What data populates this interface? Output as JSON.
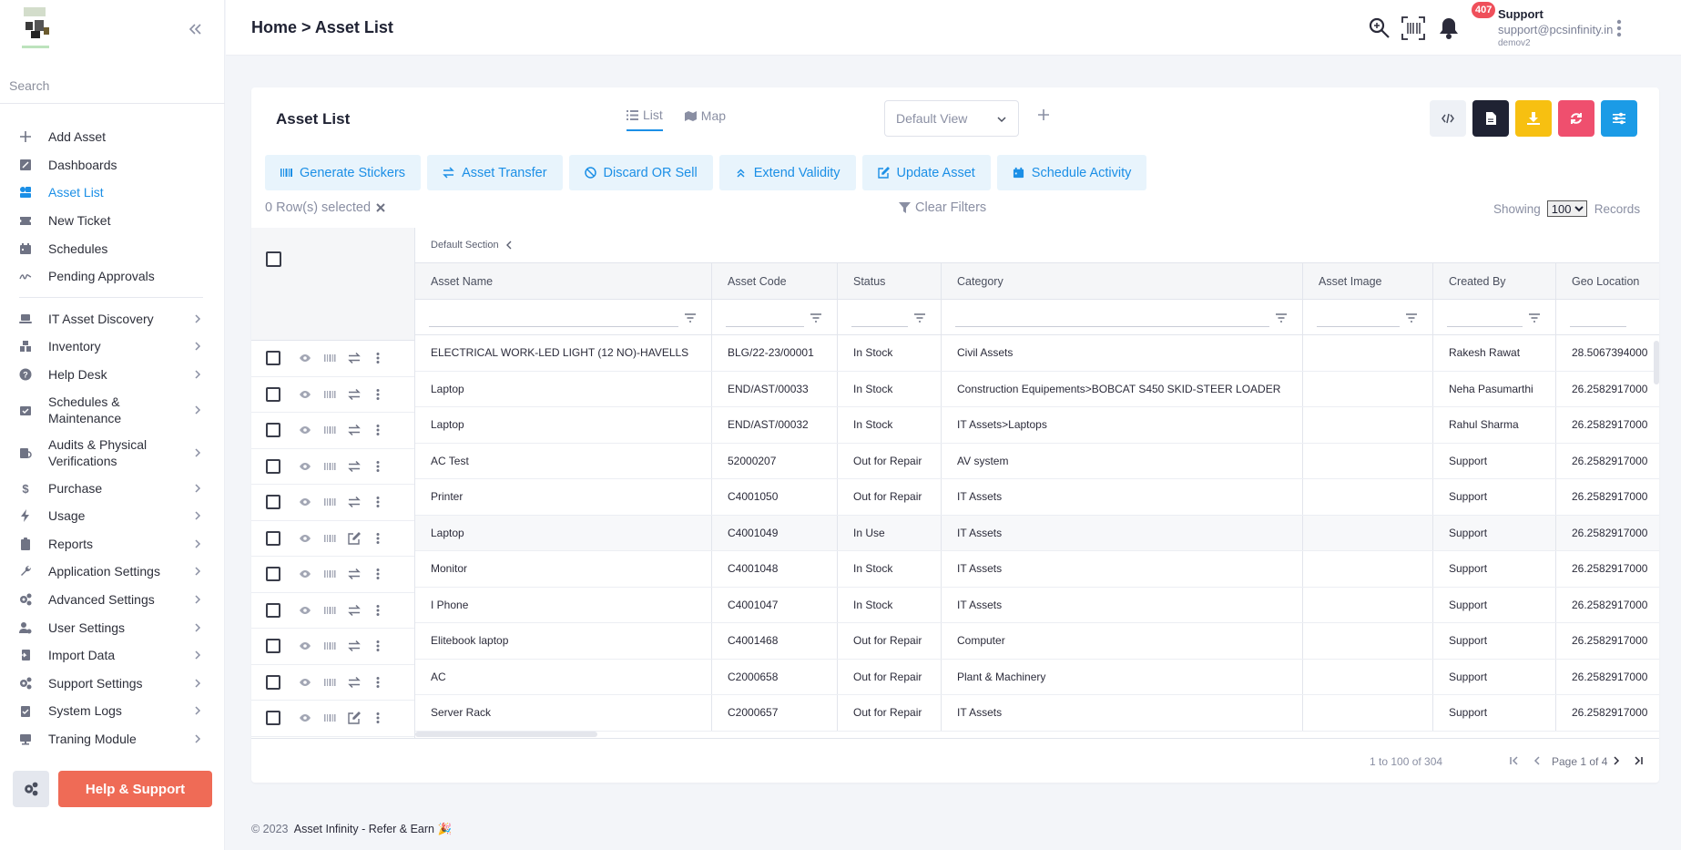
{
  "sidebar": {
    "search_placeholder": "Search",
    "primary_items": [
      {
        "label": "Add Asset",
        "icon": "plus-icon"
      },
      {
        "label": "Dashboards",
        "icon": "dashboard-icon"
      },
      {
        "label": "Asset List",
        "icon": "asset-list-icon",
        "active": true
      },
      {
        "label": "New Ticket",
        "icon": "ticket-icon"
      },
      {
        "label": "Schedules",
        "icon": "calendar-icon"
      },
      {
        "label": "Pending Approvals",
        "icon": "signature-icon"
      }
    ],
    "group_items": [
      {
        "label": "IT Asset Discovery",
        "icon": "laptop-icon"
      },
      {
        "label": "Inventory",
        "icon": "inventory-icon"
      },
      {
        "label": "Help Desk",
        "icon": "question-icon"
      },
      {
        "label": "Schedules & Maintenance",
        "icon": "calendar-check-icon"
      },
      {
        "label": "Audits & Physical Verifications",
        "icon": "audit-icon"
      },
      {
        "label": "Purchase",
        "icon": "dollar-icon"
      },
      {
        "label": "Usage",
        "icon": "bolt-icon"
      },
      {
        "label": "Reports",
        "icon": "clipboard-icon"
      },
      {
        "label": "Application Settings",
        "icon": "wrench-icon"
      },
      {
        "label": "Advanced Settings",
        "icon": "cogs-icon"
      },
      {
        "label": "User Settings",
        "icon": "user-cog-icon"
      },
      {
        "label": "Import Data",
        "icon": "import-icon"
      },
      {
        "label": "Support Settings",
        "icon": "cogs-icon"
      },
      {
        "label": "System Logs",
        "icon": "clipboard-check-icon"
      },
      {
        "label": "Traning Module",
        "icon": "training-icon"
      }
    ],
    "help_label": "Help & Support"
  },
  "header": {
    "breadcrumb": "Home > Asset List",
    "notification_count": "407",
    "user_name": "Support",
    "user_email": "support@pcsinfinity.in",
    "user_org": "demov2"
  },
  "card": {
    "title": "Asset List",
    "tabs": [
      {
        "label": "List",
        "icon": "list-icon"
      },
      {
        "label": "Map",
        "icon": "map-icon"
      }
    ],
    "view_select": "Default View",
    "actions": [
      {
        "label": "Generate Stickers",
        "icon": "barcode-icon"
      },
      {
        "label": "Asset Transfer",
        "icon": "transfer-icon"
      },
      {
        "label": "Discard OR Sell",
        "icon": "ban-icon"
      },
      {
        "label": "Extend Validity",
        "icon": "double-up-icon"
      },
      {
        "label": "Update Asset",
        "icon": "edit-icon"
      },
      {
        "label": "Schedule Activity",
        "icon": "calendar-icon"
      }
    ],
    "tool_colors": {
      "code": "#eef1f6",
      "pdf": "#1f2233",
      "download": "#f7c011",
      "refresh": "#ef4f6e",
      "settings": "#1b9be6"
    },
    "selected_count": "0",
    "selected_label": "Row(s) selected",
    "clear_filters": "Clear Filters",
    "showing_label": "Showing",
    "page_size": "100",
    "records_label": "Records"
  },
  "grid": {
    "section": "Default Section",
    "columns": [
      "Asset Name",
      "Asset Code",
      "Status",
      "Category",
      "Asset Image",
      "Created By",
      "Geo Location"
    ],
    "rows": [
      {
        "name": "ELECTRICAL WORK-LED LIGHT (12 NO)-HAVELLS",
        "code": "BLG/22-23/00001",
        "status": "In Stock",
        "category": "Civil Assets",
        "image": "",
        "created_by": "Rakesh Rawat",
        "geo": "28.5067394000",
        "edit": false
      },
      {
        "name": "Laptop",
        "code": "END/AST/00033",
        "status": "In Stock",
        "category": "Construction Equipements>BOBCAT S450 SKID-STEER LOADER",
        "image": "",
        "created_by": "Neha Pasumarthi",
        "geo": "26.2582917000",
        "edit": false
      },
      {
        "name": "Laptop",
        "code": "END/AST/00032",
        "status": "In Stock",
        "category": "IT Assets>Laptops",
        "image": "",
        "created_by": "Rahul Sharma",
        "geo": "26.2582917000",
        "edit": false
      },
      {
        "name": "AC Test",
        "code": "52000207",
        "status": "Out for Repair",
        "category": "AV system",
        "image": "",
        "created_by": "Support",
        "geo": "26.2582917000",
        "edit": false
      },
      {
        "name": "Printer",
        "code": "C4001050",
        "status": "Out for Repair",
        "category": "IT Assets",
        "image": "",
        "created_by": "Support",
        "geo": "26.2582917000",
        "edit": false
      },
      {
        "name": "Laptop",
        "code": "C4001049",
        "status": "In Use",
        "category": "IT Assets",
        "image": "",
        "created_by": "Support",
        "geo": "26.2582917000",
        "edit": true
      },
      {
        "name": "Monitor",
        "code": "C4001048",
        "status": "In Stock",
        "category": "IT Assets",
        "image": "",
        "created_by": "Support",
        "geo": "26.2582917000",
        "edit": false
      },
      {
        "name": "I Phone",
        "code": "C4001047",
        "status": "In Stock",
        "category": "IT Assets",
        "image": "",
        "created_by": "Support",
        "geo": "26.2582917000",
        "edit": false
      },
      {
        "name": "Elitebook laptop",
        "code": "C4001468",
        "status": "Out for Repair",
        "category": "Computer",
        "image": "",
        "created_by": "Support",
        "geo": "26.2582917000",
        "edit": false
      },
      {
        "name": "AC",
        "code": "C2000658",
        "status": "Out for Repair",
        "category": "Plant & Machinery",
        "image": "",
        "created_by": "Support",
        "geo": "26.2582917000",
        "edit": false
      },
      {
        "name": "Server Rack",
        "code": "C2000657",
        "status": "Out for Repair",
        "category": "IT Assets",
        "image": "",
        "created_by": "Support",
        "geo": "26.2582917000",
        "edit": true
      }
    ]
  },
  "pager": {
    "range": "1 to 100 of 304",
    "page": "Page 1 of 4"
  },
  "footer": {
    "copyright": "© 2023",
    "brand": "Asset Infinity - Refer & Earn 🎉"
  }
}
